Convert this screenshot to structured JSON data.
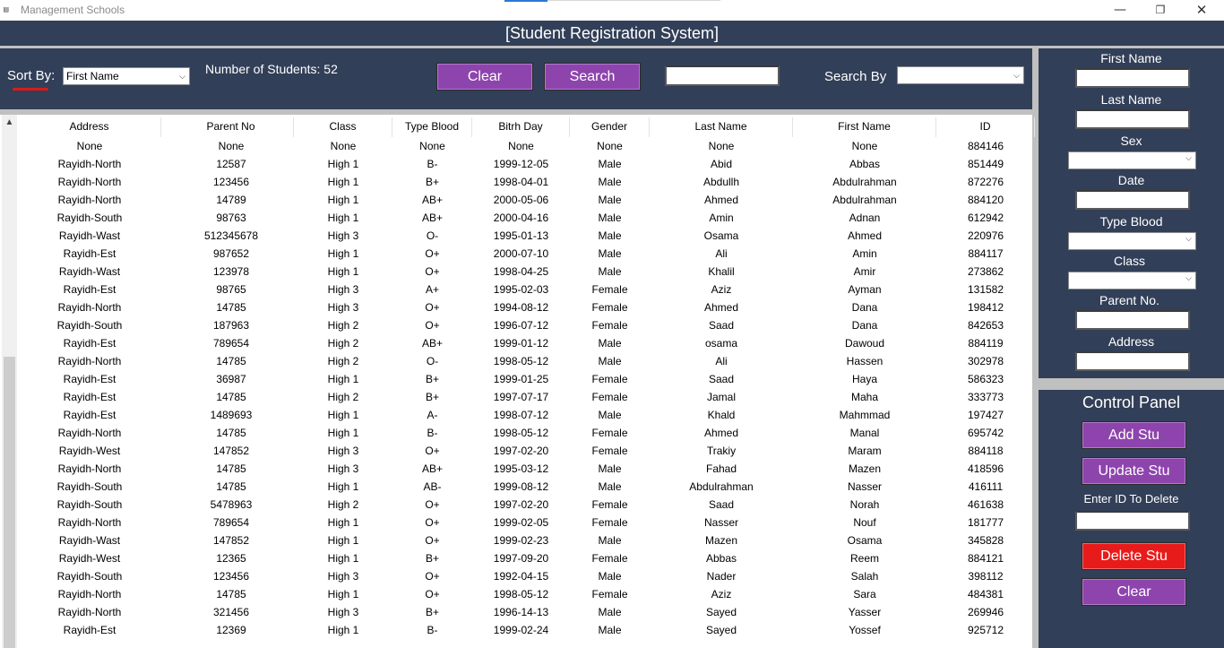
{
  "window": {
    "title": "Management Schools",
    "minimize": "—",
    "maximize": "❐",
    "close": "✕"
  },
  "header": {
    "title": "[Student Registration System]"
  },
  "toolbar": {
    "sort_label": "Sort By:",
    "sort_value": "First Name",
    "count_label": "Number of Students: 52",
    "clear_label": "Clear",
    "search_label": "Search",
    "search_value": "",
    "search_by_label": "Search By",
    "search_by_value": ""
  },
  "table": {
    "columns": [
      "Address",
      "Parent No",
      "Class",
      "Type Blood",
      "Bitrh Day",
      "Gender",
      "Last Name",
      "First Name",
      "ID"
    ],
    "rows": [
      [
        "None",
        "None",
        "None",
        "None",
        "None",
        "None",
        "None",
        "None",
        "884146"
      ],
      [
        "Rayidh-North",
        "12587",
        "High 1",
        "B-",
        "1999-12-05",
        "Male",
        "Abid",
        "Abbas",
        "851449"
      ],
      [
        "Rayidh-North",
        "123456",
        "High 1",
        "B+",
        "1998-04-01",
        "Male",
        "Abdullh",
        "Abdulrahman",
        "872276"
      ],
      [
        "Rayidh-North",
        "14789",
        "High 1",
        "AB+",
        "2000-05-06",
        "Male",
        "Ahmed",
        "Abdulrahman",
        "884120"
      ],
      [
        "Rayidh-South",
        "98763",
        "High 1",
        "AB+",
        "2000-04-16",
        "Male",
        "Amin",
        "Adnan",
        "612942"
      ],
      [
        "Rayidh-Wast",
        "512345678",
        "High 3",
        "O-",
        "1995-01-13",
        "Male",
        "Osama",
        "Ahmed",
        "220976"
      ],
      [
        "Rayidh-Est",
        "987652",
        "High 1",
        "O+",
        "2000-07-10",
        "Male",
        "Ali",
        "Amin",
        "884117"
      ],
      [
        "Rayidh-Wast",
        "123978",
        "High 1",
        "O+",
        "1998-04-25",
        "Male",
        "Khalil",
        "Amir",
        "273862"
      ],
      [
        "Rayidh-Est",
        "98765",
        "High 3",
        "A+",
        "1995-02-03",
        "Female",
        "Aziz",
        "Ayman",
        "131582"
      ],
      [
        "Rayidh-North",
        "14785",
        "High 3",
        "O+",
        "1994-08-12",
        "Female",
        "Ahmed",
        "Dana",
        "198412"
      ],
      [
        "Rayidh-South",
        "187963",
        "High 2",
        "O+",
        "1996-07-12",
        "Female",
        "Saad",
        "Dana",
        "842653"
      ],
      [
        "Rayidh-Est",
        "789654",
        "High 2",
        "AB+",
        "1999-01-12",
        "Male",
        "osama",
        "Dawoud",
        "884119"
      ],
      [
        "Rayidh-North",
        "14785",
        "High 2",
        "O-",
        "1998-05-12",
        "Male",
        "Ali",
        "Hassen",
        "302978"
      ],
      [
        "Rayidh-Est",
        "36987",
        "High 1",
        "B+",
        "1999-01-25",
        "Female",
        "Saad",
        "Haya",
        "586323"
      ],
      [
        "Rayidh-Est",
        "14785",
        "High 2",
        "B+",
        "1997-07-17",
        "Female",
        "Jamal",
        "Maha",
        "333773"
      ],
      [
        "Rayidh-Est",
        "1489693",
        "High 1",
        "A-",
        "1998-07-12",
        "Male",
        "Khald",
        "Mahmmad",
        "197427"
      ],
      [
        "Rayidh-North",
        "14785",
        "High 1",
        "B-",
        "1998-05-12",
        "Female",
        "Ahmed",
        "Manal",
        "695742"
      ],
      [
        "Rayidh-West",
        "147852",
        "High 3",
        "O+",
        "1997-02-20",
        "Female",
        "Trakiy",
        "Maram",
        "884118"
      ],
      [
        "Rayidh-North",
        "14785",
        "High 3",
        "AB+",
        "1995-03-12",
        "Male",
        "Fahad",
        "Mazen",
        "418596"
      ],
      [
        "Rayidh-South",
        "14785",
        "High 1",
        "AB-",
        "1999-08-12",
        "Male",
        "Abdulrahman",
        "Nasser",
        "416111"
      ],
      [
        "Rayidh-South",
        "5478963",
        "High 2",
        "O+",
        "1997-02-20",
        "Female",
        "Saad",
        "Norah",
        "461638"
      ],
      [
        "Rayidh-North",
        "789654",
        "High 1",
        "O+",
        "1999-02-05",
        "Female",
        "Nasser",
        "Nouf",
        "181777"
      ],
      [
        "Rayidh-Wast",
        "147852",
        "High 1",
        "O+",
        "1999-02-23",
        "Male",
        "Mazen",
        "Osama",
        "345828"
      ],
      [
        "Rayidh-West",
        "12365",
        "High 1",
        "B+",
        "1997-09-20",
        "Female",
        "Abbas",
        "Reem",
        "884121"
      ],
      [
        "Rayidh-South",
        "123456",
        "High 3",
        "O+",
        "1992-04-15",
        "Male",
        "Nader",
        "Salah",
        "398112"
      ],
      [
        "Rayidh-North",
        "14785",
        "High 1",
        "O+",
        "1998-05-12",
        "Female",
        "Aziz",
        "Sara",
        "484381"
      ],
      [
        "Rayidh-North",
        "321456",
        "High 3",
        "B+",
        "1996-14-13",
        "Male",
        "Sayed",
        "Yasser",
        "269946"
      ],
      [
        "Rayidh-Est",
        "12369",
        "High 1",
        "B-",
        "1999-02-24",
        "Male",
        "Sayed",
        "Yossef",
        "925712"
      ]
    ]
  },
  "form": {
    "first_name_label": "First Name",
    "last_name_label": "Last Name",
    "sex_label": "Sex",
    "date_label": "Date",
    "type_blood_label": "Type Blood",
    "class_label": "Class",
    "parent_no_label": "Parent No.",
    "address_label": "Address"
  },
  "control_panel": {
    "title": "Control Panel",
    "add_label": "Add Stu",
    "update_label": "Update Stu",
    "delete_id_label": "Enter ID To Delete",
    "delete_label": "Delete Stu",
    "clear_label": "Clear"
  },
  "colors": {
    "panel": "#323f58",
    "button_purple": "#8e44ad",
    "button_red": "#e81b1b"
  }
}
